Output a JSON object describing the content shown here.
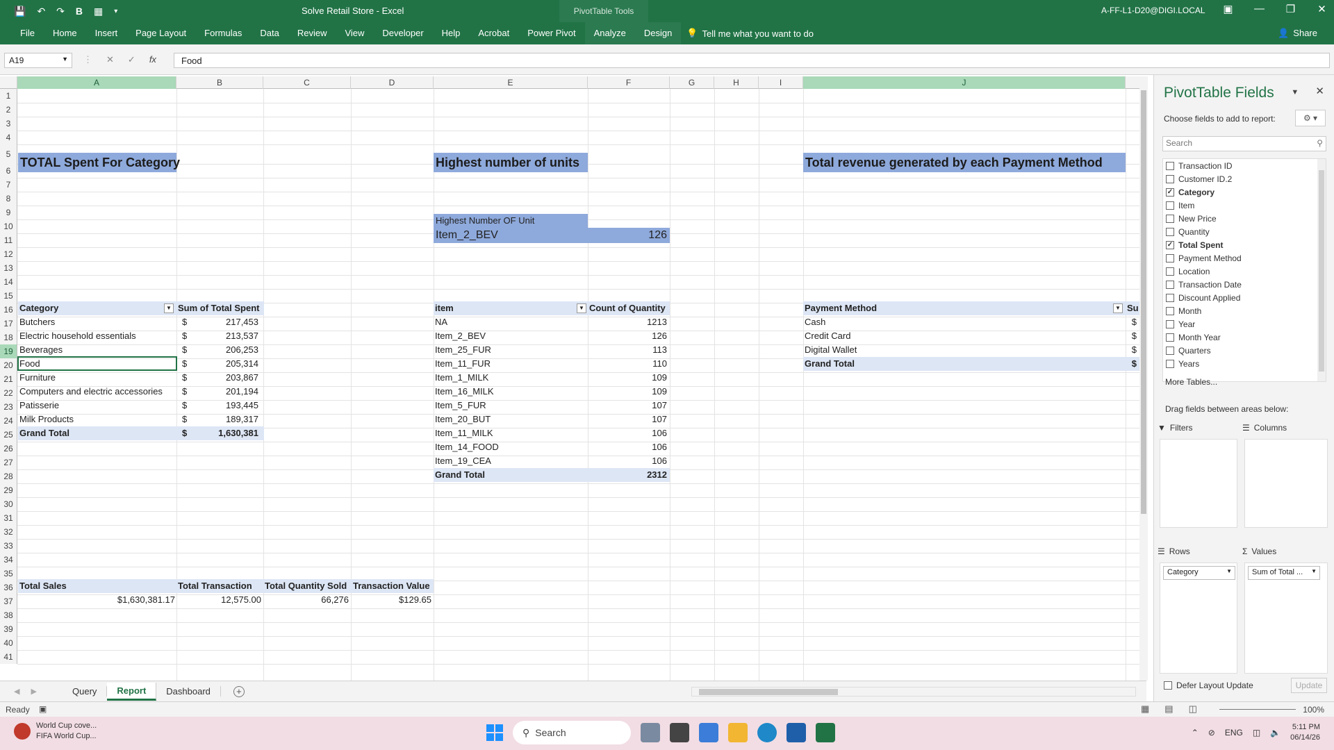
{
  "window": {
    "title": "Solve Retail Store  -  Excel",
    "context_tab": "PivotTable Tools",
    "user": "A-FF-L1-D20@DIGI.LOCAL"
  },
  "ribbon": {
    "tabs": [
      "File",
      "Home",
      "Insert",
      "Page Layout",
      "Formulas",
      "Data",
      "Review",
      "View",
      "Developer",
      "Help",
      "Acrobat",
      "Power Pivot",
      "Analyze",
      "Design"
    ],
    "tell_me": "Tell me what you want to do",
    "share": "Share"
  },
  "formula_bar": {
    "name_box": "A19",
    "formula": "Food"
  },
  "columns": [
    "A",
    "B",
    "C",
    "D",
    "E",
    "F",
    "G",
    "H",
    "I",
    "J"
  ],
  "rows": [
    "1",
    "2",
    "3",
    "4",
    "5",
    "6",
    "7",
    "8",
    "9",
    "10",
    "11",
    "12",
    "13",
    "14",
    "15",
    "16",
    "17",
    "18",
    "19",
    "20",
    "21",
    "22",
    "23",
    "24",
    "25",
    "26",
    "27",
    "28",
    "29",
    "30",
    "31",
    "32",
    "33",
    "34",
    "35",
    "36",
    "37",
    "38",
    "39",
    "40",
    "41"
  ],
  "sheet": {
    "title_category": "TOTAL Spent For Category",
    "title_units": "Highest number of units",
    "title_payment": "Total revenue generated by each Payment Method",
    "highest_label": "Highest Number OF Unit",
    "highest_item": "Item_2_BEV",
    "highest_value": "126",
    "cat_pivot": {
      "header_label": "Category",
      "header_value": "Sum of Total Spent",
      "rows": [
        {
          "label": "Butchers",
          "cur": "$",
          "value": "217,453"
        },
        {
          "label": "Electric household essentials",
          "cur": "$",
          "value": "213,537"
        },
        {
          "label": "Beverages",
          "cur": "$",
          "value": "206,253"
        },
        {
          "label": "Food",
          "cur": "$",
          "value": "205,314"
        },
        {
          "label": "Furniture",
          "cur": "$",
          "value": "203,867"
        },
        {
          "label": "Computers and electric accessories",
          "cur": "$",
          "value": "201,194"
        },
        {
          "label": "Patisserie",
          "cur": "$",
          "value": "193,445"
        },
        {
          "label": "Milk Products",
          "cur": "$",
          "value": "189,317"
        }
      ],
      "total_label": "Grand Total",
      "total_cur": "$",
      "total_value": "1,630,381"
    },
    "item_pivot": {
      "header_label": "item",
      "header_value": "Count of Quantity",
      "rows": [
        {
          "label": "NA",
          "value": "1213"
        },
        {
          "label": "Item_2_BEV",
          "value": "126"
        },
        {
          "label": "Item_25_FUR",
          "value": "113"
        },
        {
          "label": "Item_11_FUR",
          "value": "110"
        },
        {
          "label": "Item_1_MILK",
          "value": "109"
        },
        {
          "label": "Item_16_MILK",
          "value": "109"
        },
        {
          "label": "Item_5_FUR",
          "value": "107"
        },
        {
          "label": "Item_20_BUT",
          "value": "107"
        },
        {
          "label": "Item_11_MILK",
          "value": "106"
        },
        {
          "label": "Item_14_FOOD",
          "value": "106"
        },
        {
          "label": "Item_19_CEA",
          "value": "106"
        }
      ],
      "total_label": "Grand Total",
      "total_value": "2312"
    },
    "pay_pivot": {
      "header_label": "Payment Method",
      "header_value": "Su",
      "rows": [
        {
          "label": "Cash",
          "value": "$"
        },
        {
          "label": "Credit Card",
          "value": "$"
        },
        {
          "label": "Digital Wallet",
          "value": "$"
        }
      ],
      "total_label": "Grand Total",
      "total_value": "$"
    },
    "kpi": {
      "headers": [
        "Total Sales",
        "Total Transaction",
        "Total Quantity Sold",
        "Transaction Value"
      ],
      "values": [
        "$1,630,381.17",
        "12,575.00",
        "66,276",
        "$129.65"
      ]
    }
  },
  "sheet_tabs": [
    "Query",
    "Report",
    "Dashboard"
  ],
  "active_sheet": "Report",
  "status": {
    "ready": "Ready",
    "zoom": "100%"
  },
  "pivot_pane": {
    "title": "PivotTable Fields",
    "choose": "Choose fields to add to report:",
    "search_placeholder": "Search",
    "fields": [
      {
        "name": "Transaction ID",
        "checked": false
      },
      {
        "name": "Customer ID.2",
        "checked": false
      },
      {
        "name": "Category",
        "checked": true
      },
      {
        "name": "Item",
        "checked": false
      },
      {
        "name": "New Price",
        "checked": false
      },
      {
        "name": "Quantity",
        "checked": false
      },
      {
        "name": "Total Spent",
        "checked": true
      },
      {
        "name": "Payment Method",
        "checked": false
      },
      {
        "name": "Location",
        "checked": false
      },
      {
        "name": "Transaction Date",
        "checked": false
      },
      {
        "name": "Discount Applied",
        "checked": false
      },
      {
        "name": "Month",
        "checked": false
      },
      {
        "name": "Year",
        "checked": false
      },
      {
        "name": "Month Year",
        "checked": false
      },
      {
        "name": "Quarters",
        "checked": false
      },
      {
        "name": "Years",
        "checked": false
      }
    ],
    "more_tables": "More Tables...",
    "drag_text": "Drag fields between areas below:",
    "filters_label": "Filters",
    "columns_label": "Columns",
    "rows_label": "Rows",
    "values_label": "Values",
    "rows_item": "Category",
    "values_item": "Sum of Total ...",
    "defer": "Defer Layout Update",
    "update": "Update"
  },
  "taskbar": {
    "news_title": "World Cup cove...",
    "news_sub": "FIFA World Cup...",
    "search": "Search",
    "lang": "ENG",
    "time": "5:11 PM",
    "date": "06/14/26"
  }
}
